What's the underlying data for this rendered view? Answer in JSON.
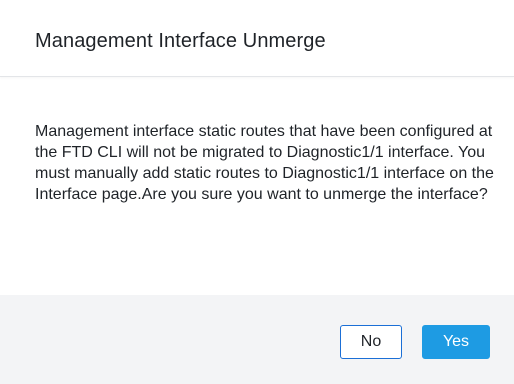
{
  "dialog": {
    "title": "Management Interface Unmerge",
    "message": "Management interface static routes that have been configured at the FTD CLI will not be migrated to Diagnostic1/1 interface. You must manually add static routes to Diagnostic1/1 interface on the Interface page.Are you sure you want to unmerge the interface?",
    "buttons": {
      "no_label": "No",
      "yes_label": "Yes"
    }
  },
  "colors": {
    "primary_button": "#1e9be3",
    "secondary_button_border": "#1b6fd6",
    "footer_background": "#f3f4f6",
    "text": "#1f2328"
  }
}
